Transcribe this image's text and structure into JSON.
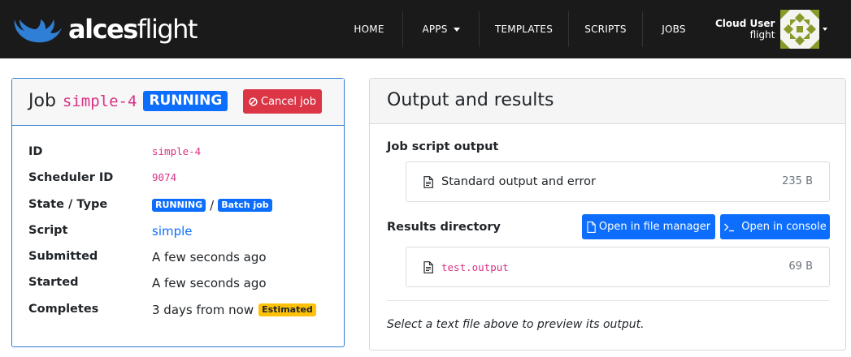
{
  "navbar": {
    "brand_bold": "alces",
    "brand_light": "flight",
    "items": [
      {
        "label": "HOME"
      },
      {
        "label": "APPS"
      },
      {
        "label": "TEMPLATES"
      },
      {
        "label": "SCRIPTS"
      },
      {
        "label": "JOBS"
      }
    ],
    "user": {
      "display_name": "Cloud User",
      "username": "flight"
    }
  },
  "job": {
    "title_word": "Job",
    "name": "simple-4",
    "state_badge": "RUNNING",
    "cancel_label": "Cancel job",
    "properties": {
      "id": {
        "label": "ID",
        "value": "simple-4"
      },
      "scheduler_id": {
        "label": "Scheduler ID",
        "value": "9074"
      },
      "state_type": {
        "label": "State / Type",
        "state": "RUNNING",
        "separator": "/",
        "type": "Batch job"
      },
      "script": {
        "label": "Script",
        "value": "simple"
      },
      "submitted": {
        "label": "Submitted",
        "value": "A few seconds ago"
      },
      "started": {
        "label": "Started",
        "value": "A few seconds ago"
      },
      "completes": {
        "label": "Completes",
        "value": "3 days from now",
        "badge": "Estimated"
      }
    }
  },
  "output": {
    "title": "Output and results",
    "job_script_output": {
      "heading": "Job script output",
      "file": {
        "name": "Standard output and error",
        "size": "235 B"
      }
    },
    "results_directory": {
      "heading": "Results directory",
      "open_file_manager": "Open in file manager",
      "open_console": "Open in console",
      "file": {
        "name": "test.output",
        "size": "69 B"
      }
    },
    "hint": "Select a text file above to preview its output."
  },
  "colors": {
    "navbar_bg": "#1a1a1a",
    "brand_blue": "#2f7fd6",
    "primary": "#0d6efd",
    "danger": "#dc3545",
    "warning": "#ffc107",
    "code_pink": "#d63384"
  },
  "icons": [
    "alces-antler-logo-icon",
    "caret-down-icon",
    "user-avatar",
    "ban-icon",
    "file-text-icon",
    "file-icon",
    "terminal-icon"
  ]
}
